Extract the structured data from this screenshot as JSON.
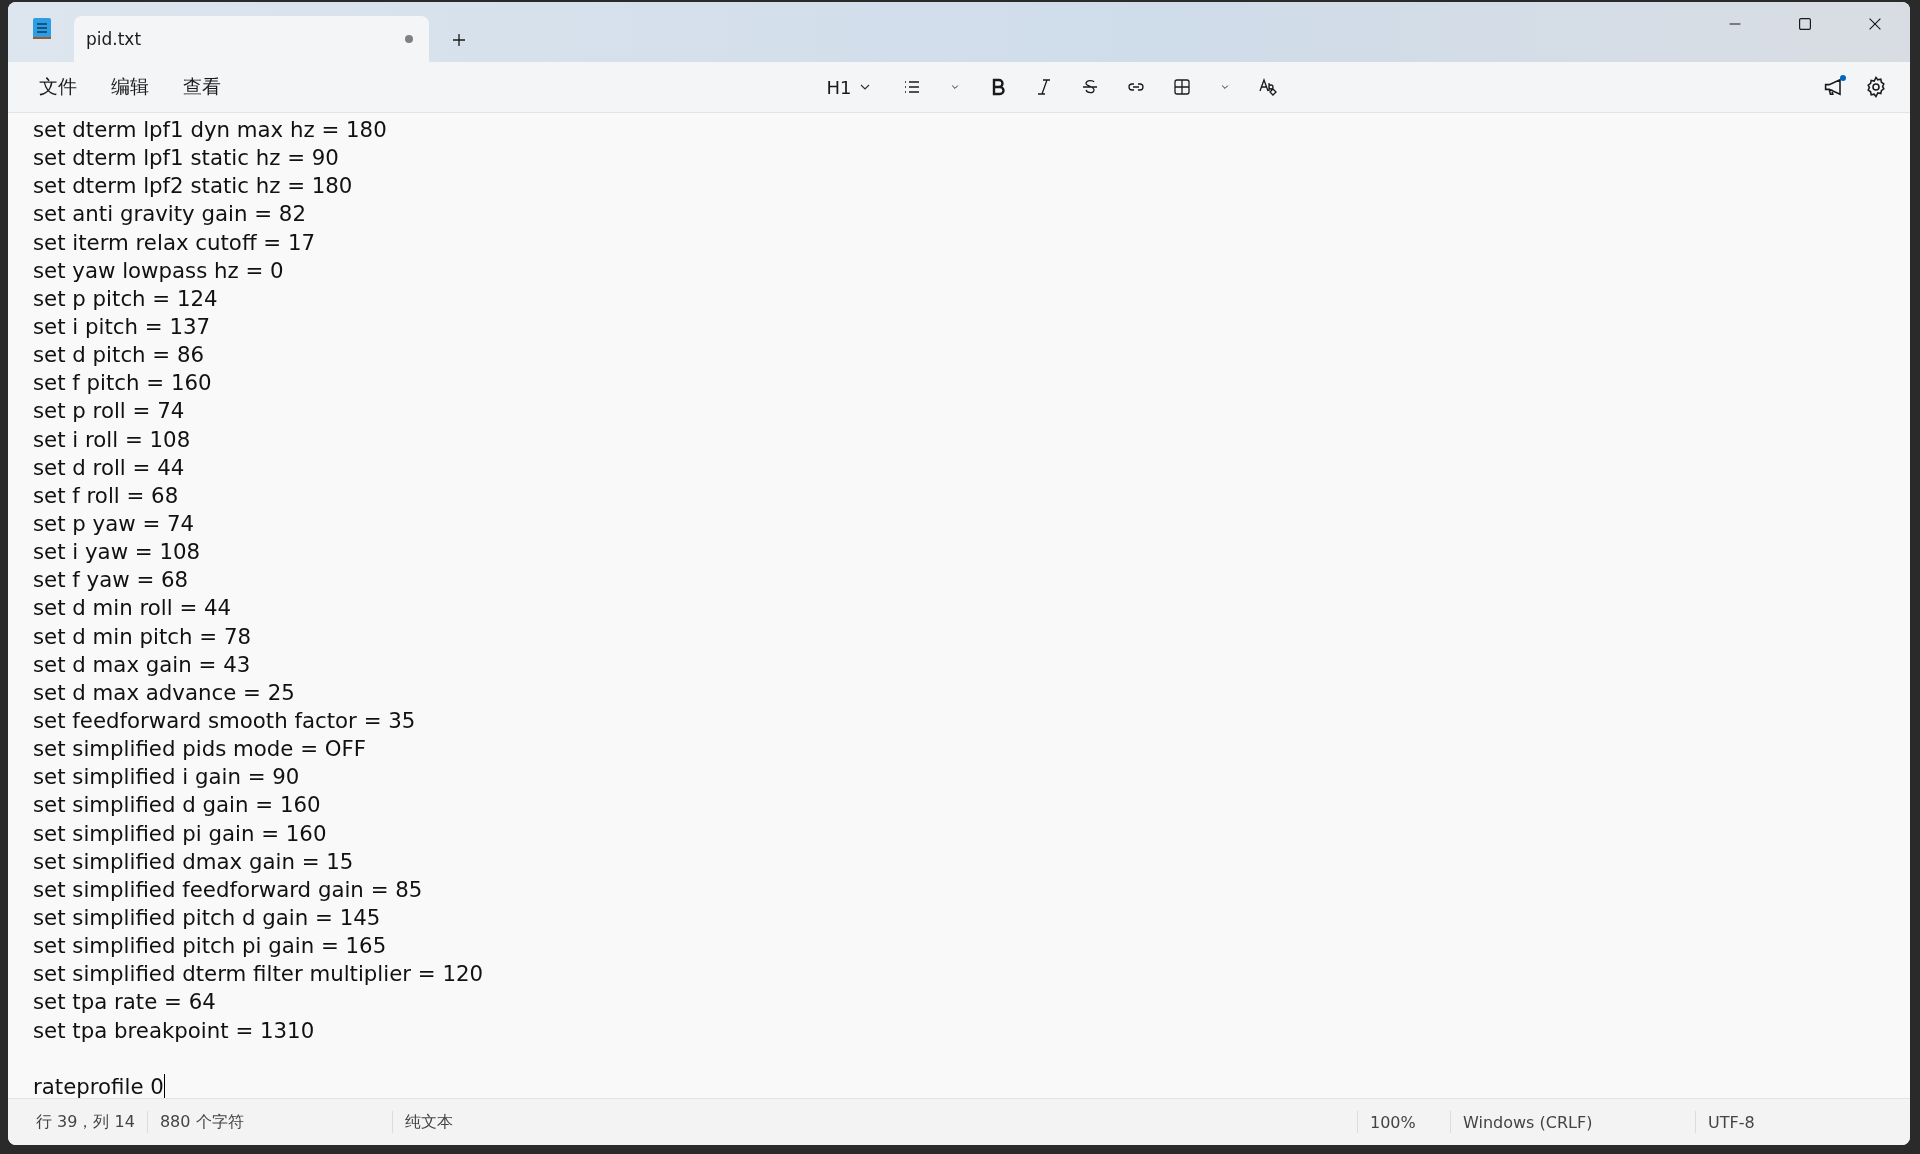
{
  "tabs": [
    {
      "label": "pid.txt",
      "selected": true,
      "modified": true
    }
  ],
  "menu": [
    "文件",
    "编辑",
    "查看"
  ],
  "toolbar": {
    "heading": "H1"
  },
  "notification": true,
  "lines": [
    "set dterm lpf1 dyn max hz = 180",
    "set dterm lpf1 static hz = 90",
    "set dterm lpf2 static hz = 180",
    "set anti gravity gain = 82",
    "set iterm relax cutoff = 17",
    "set yaw lowpass hz = 0",
    "set p pitch = 124",
    "set i pitch = 137",
    "set d pitch = 86",
    "set f pitch = 160",
    "set p roll = 74",
    "set i roll = 108",
    "set d roll = 44",
    "set f roll = 68",
    "set p yaw = 74",
    "set i yaw = 108",
    "set f yaw = 68",
    "set d min roll = 44",
    "set d min pitch = 78",
    "set d max gain = 43",
    "set d max advance = 25",
    "set feedforward smooth factor = 35",
    "set simplified pids mode = OFF",
    "set simplified i gain = 90",
    "set simplified d gain = 160",
    "set simplified pi gain = 160",
    "set simplified dmax gain = 15",
    "set simplified feedforward gain = 85",
    "set simplified pitch d gain = 145",
    "set simplified pitch pi gain = 165",
    "set simplified dterm filter multiplier = 120",
    "set tpa rate = 64",
    "set tpa breakpoint = 1310"
  ],
  "last_line": "rateprofile 0",
  "status_bar": {
    "position": "行 39，列 14",
    "count": "880 个字符",
    "format": "纯文本",
    "zoom": "100%",
    "line_ending": "Windows (CRLF)",
    "encoding": "UTF-8"
  }
}
